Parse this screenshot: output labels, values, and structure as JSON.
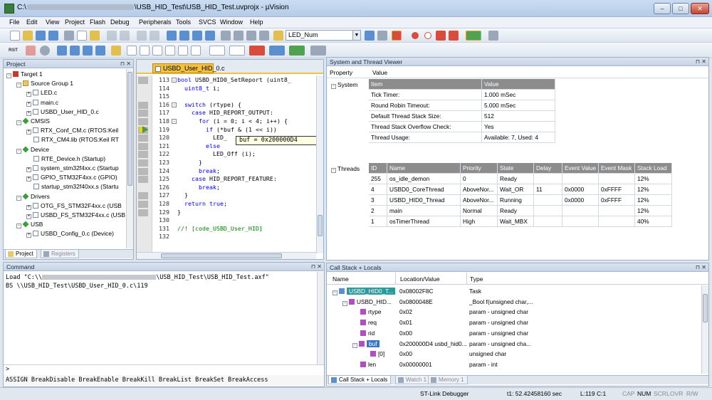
{
  "window": {
    "title_prefix": "C:\\",
    "title_suffix": "\\USB_HID_Test\\USB_HID_Test.uvprojx - µVision",
    "min": "–",
    "max": "□",
    "close": "✕"
  },
  "menu": [
    "File",
    "Edit",
    "View",
    "Project",
    "Flash",
    "Debug",
    "Peripherals",
    "Tools",
    "SVCS",
    "Window",
    "Help"
  ],
  "toolbar": {
    "target": "LED_Num",
    "rst": "RST"
  },
  "project": {
    "header": "Project",
    "tree": [
      {
        "t": "Target 1",
        "lvl": 0,
        "ico": "tgt",
        "exp": "-"
      },
      {
        "t": "Source Group 1",
        "lvl": 1,
        "ico": "folder",
        "exp": "-"
      },
      {
        "t": "LED.c",
        "lvl": 2,
        "ico": "file",
        "exp": "+"
      },
      {
        "t": "main.c",
        "lvl": 2,
        "ico": "file",
        "exp": "+"
      },
      {
        "t": "USBD_User_HID_0.c",
        "lvl": 2,
        "ico": "file",
        "exp": "+"
      },
      {
        "t": "CMSIS",
        "lvl": 1,
        "ico": "dia",
        "exp": "-"
      },
      {
        "t": "RTX_Conf_CM.c (RTOS:Keil",
        "lvl": 2,
        "ico": "file",
        "exp": "+"
      },
      {
        "t": "RTX_CM4.lib (RTOS:Keil RT",
        "lvl": 2,
        "ico": "file",
        "exp": ""
      },
      {
        "t": "Device",
        "lvl": 1,
        "ico": "dia",
        "exp": "-"
      },
      {
        "t": "RTE_Device.h (Startup)",
        "lvl": 2,
        "ico": "file",
        "exp": ""
      },
      {
        "t": "system_stm32f4xx.c (Startup",
        "lvl": 2,
        "ico": "file",
        "exp": "+"
      },
      {
        "t": "GPIO_STM32F4xx.c (GPIO)",
        "lvl": 2,
        "ico": "file",
        "exp": "+"
      },
      {
        "t": "startup_stm32f40xx.s (Startu",
        "lvl": 2,
        "ico": "file",
        "exp": ""
      },
      {
        "t": "Drivers",
        "lvl": 1,
        "ico": "dia",
        "exp": "-"
      },
      {
        "t": "OTG_FS_STM32F4xx.c (USB",
        "lvl": 2,
        "ico": "file",
        "exp": "+"
      },
      {
        "t": "USBD_FS_STM32F4xx.c (USB",
        "lvl": 2,
        "ico": "file",
        "exp": "+"
      },
      {
        "t": "USB",
        "lvl": 1,
        "ico": "dia",
        "exp": "-"
      },
      {
        "t": "USBD_Config_0.c (Device)",
        "lvl": 2,
        "ico": "file",
        "exp": "+"
      }
    ],
    "tabs": [
      "Project",
      "Registers"
    ]
  },
  "editor": {
    "tab": "USBD_User_HID_0.c",
    "lines": [
      {
        "n": "113",
        "c": "bool USBD_HID0_SetReport (uint8_"
      },
      {
        "n": "114",
        "c": "  uint8_t i;"
      },
      {
        "n": "115",
        "c": ""
      },
      {
        "n": "116",
        "c": "  switch (rtype) {"
      },
      {
        "n": "117",
        "c": "    case HID_REPORT_OUTPUT:"
      },
      {
        "n": "118",
        "c": "      for (i = 0; i < 4; i++) {"
      },
      {
        "n": "119",
        "c": "        if (*buf & (1 << i))"
      },
      {
        "n": "120",
        "c": "          LED_"
      },
      {
        "n": "121",
        "c": "        else"
      },
      {
        "n": "122",
        "c": "          LED_Off (i);"
      },
      {
        "n": "123",
        "c": "      }"
      },
      {
        "n": "124",
        "c": "      break;"
      },
      {
        "n": "125",
        "c": "    case HID_REPORT_FEATURE:"
      },
      {
        "n": "126",
        "c": "      break;"
      },
      {
        "n": "127",
        "c": "  }"
      },
      {
        "n": "128",
        "c": "  return true;"
      },
      {
        "n": "129",
        "c": "}"
      },
      {
        "n": "130",
        "c": ""
      },
      {
        "n": "131",
        "c": "//! [code_USBD_User_HID]"
      },
      {
        "n": "132",
        "c": ""
      }
    ],
    "tooltip": "buf = 0x200000D4"
  },
  "sysviewer": {
    "header": "System and Thread Viewer",
    "col_property": "Property",
    "col_value": "Value",
    "system_label": "System",
    "sys_hdr": [
      "Item",
      "Value"
    ],
    "sys_rows": [
      [
        "Tick Timer:",
        "1.000 mSec"
      ],
      [
        "Round Robin Timeout:",
        "5.000 mSec"
      ],
      [
        "Default Thread Stack Size:",
        "512"
      ],
      [
        "Thread Stack Overflow Check:",
        "Yes"
      ],
      [
        "Thread Usage:",
        "Available: 7, Used: 4"
      ]
    ],
    "threads_label": "Threads",
    "thr_hdr": [
      "ID",
      "Name",
      "Priority",
      "State",
      "Delay",
      "Event Value",
      "Event Mask",
      "Stack Load"
    ],
    "thr_rows": [
      [
        "255",
        "os_idle_demon",
        "0",
        "Ready",
        "",
        "",
        "",
        "12%"
      ],
      [
        "4",
        "USBD0_CoreThread",
        "AboveNor...",
        "Wait_OR",
        "11",
        "0x0000",
        "0xFFFF",
        "12%"
      ],
      [
        "3",
        "USBD_HID0_Thread",
        "AboveNor...",
        "Running",
        "",
        "0x0000",
        "0xFFFF",
        "12%"
      ],
      [
        "2",
        "main",
        "Normal",
        "Ready",
        "",
        "",
        "",
        "12%"
      ],
      [
        "1",
        "osTimerThread",
        "High",
        "Wait_MBX",
        "",
        "",
        "",
        "40%"
      ]
    ]
  },
  "command": {
    "header": "Command",
    "line1_a": "Load \"C:\\\\",
    "line1_b": "\\USB_HID_Test\\USB_HID_Test.axf\"",
    "line2": "BS \\\\USB_HID_Test\\USBD_User_HID_0.c\\119",
    "prompt": ">",
    "hint": "ASSIGN BreakDisable BreakEnable BreakKill BreakList BreakSet BreakAccess"
  },
  "callstack": {
    "header": "Call Stack + Locals",
    "cols": [
      "Name",
      "Location/Value",
      "Type"
    ],
    "rows": [
      {
        "n": "USBD_HID0_T...",
        "v": "0x08002F8C",
        "t": "Task",
        "lvl": 0,
        "exp": "-",
        "sel": true
      },
      {
        "n": "USBD_HID...",
        "v": "0x0800048E",
        "t": "_Bool f(unsigned char,...",
        "lvl": 1,
        "exp": "-",
        "sel": false
      },
      {
        "n": "rtype",
        "v": "0x02",
        "t": "param - unsigned char",
        "lvl": 2,
        "exp": "",
        "sel": false
      },
      {
        "n": "req",
        "v": "0x01",
        "t": "param - unsigned char",
        "lvl": 2,
        "exp": "",
        "sel": false
      },
      {
        "n": "rid",
        "v": "0x00",
        "t": "param - unsigned char",
        "lvl": 2,
        "exp": "",
        "sel": false
      },
      {
        "n": "buf",
        "v": "0x200000D4 usbd_hid0...",
        "t": "param - unsigned cha...",
        "lvl": 2,
        "exp": "-",
        "sel": true
      },
      {
        "n": "[0]",
        "v": "0x00",
        "t": "unsigned char",
        "lvl": 3,
        "exp": "",
        "sel": false
      },
      {
        "n": "len",
        "v": "0x00000001",
        "t": "param - int",
        "lvl": 2,
        "exp": "",
        "sel": false
      }
    ],
    "tabs": [
      "Call Stack + Locals",
      "Watch 1",
      "Memory 1"
    ]
  },
  "status": {
    "debugger": "ST-Link Debugger",
    "time": "t1: 52.42458160 sec",
    "pos": "L:119 C:1",
    "cap": "CAP",
    "num": "NUM",
    "scrl": "SCRL",
    "ovr": "OVR",
    "rw": "R/W"
  }
}
